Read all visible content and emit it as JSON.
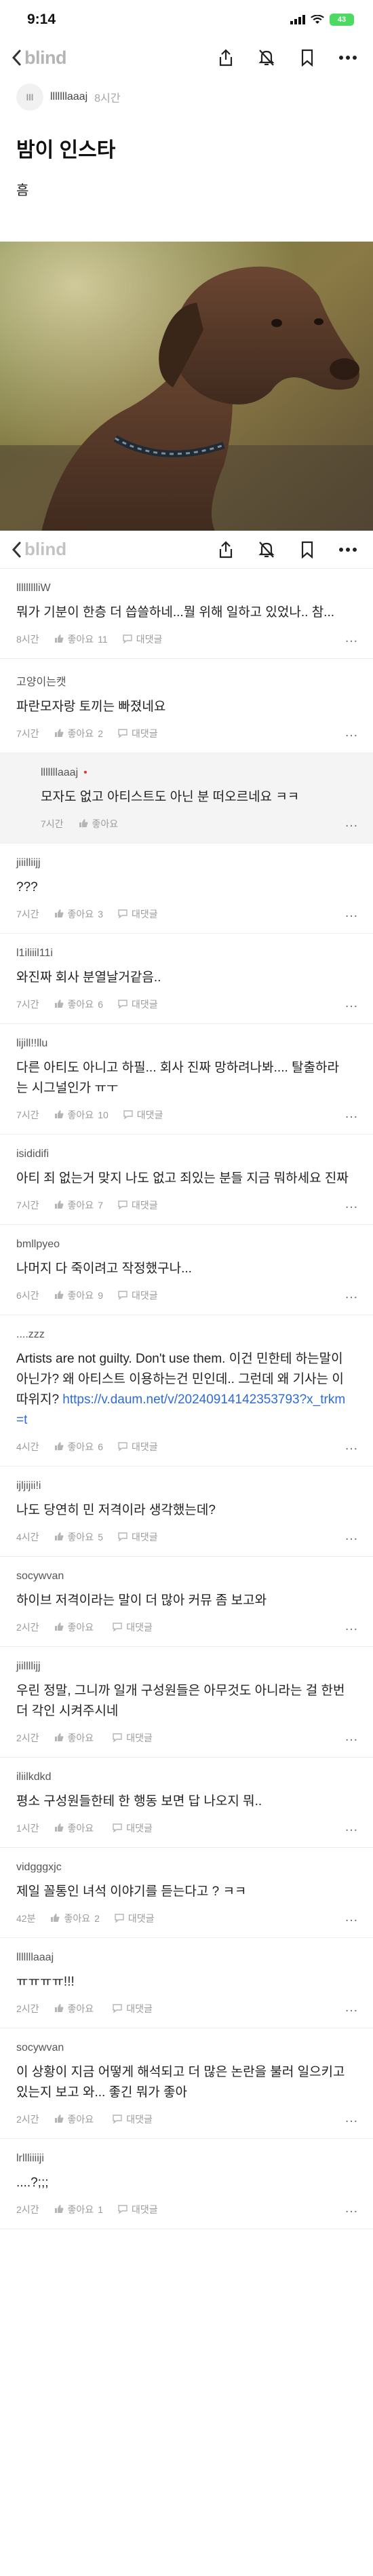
{
  "status": {
    "time": "9:14",
    "battery": "43"
  },
  "nav": {
    "brand": "blind"
  },
  "post": {
    "author": "lllllllaaaj",
    "avatar": "lll",
    "time": "8시간",
    "title": "밤이 인스타",
    "body": "흠"
  },
  "labels": {
    "like": "좋아요",
    "reply": "대댓글"
  },
  "comments": [
    {
      "name": "llllllllliW",
      "text": "뭐가 기분이 한층 더 씁쓸하네...뭘 위해 일하고 있었나.. 참...",
      "time": "8시간",
      "likes": "11",
      "reply": true
    },
    {
      "name": "고양이는캣",
      "text": "파란모자랑 토끼는 빠졌네요",
      "time": "7시간",
      "likes": "2",
      "reply": true
    },
    {
      "name": "lllllllaaaj",
      "badge": "•",
      "text": "모자도 없고 아티스트도 아닌 분 떠오르네요 ㅋㅋ",
      "time": "7시간",
      "likes": "",
      "reply": false,
      "nested": true
    },
    {
      "name": "jiiilliijj",
      "text": "???",
      "time": "7시간",
      "likes": "3",
      "reply": true
    },
    {
      "name": "l1iliiil11i",
      "text": "와진짜 회사 분열날거같음..",
      "time": "7시간",
      "likes": "6",
      "reply": true
    },
    {
      "name": "lijill!!llu",
      "text": "다른 아티도 아니고 하필... 회사 진짜 망하려나봐.... 탈출하라는 시그널인가 ㅠㅜ",
      "time": "7시간",
      "likes": "10",
      "reply": true
    },
    {
      "name": "isididifi",
      "text": "아티 죄 없는거 맞지 나도 없고 죄있는 분들 지금 뭐하세요 진짜",
      "time": "7시간",
      "likes": "7",
      "reply": true
    },
    {
      "name": "bmllpyeo",
      "text": "나머지 다 죽이려고 작정했구나...",
      "time": "6시간",
      "likes": "9",
      "reply": true
    },
    {
      "name": "....zzz",
      "text": "Artists are not guilty.  Don't use them. 이건 민한테 하는말이 아닌가? 왜 아티스트 이용하는건 민인데.. 그런데 왜 기사는 이따위지? ",
      "link": "https://v.daum.net/v/20240914142353793?x_trkm=t",
      "time": "4시간",
      "likes": "6",
      "reply": true
    },
    {
      "name": "ijljijii!i",
      "text": "나도 당연히 민 저격이라 생각했는데?",
      "time": "4시간",
      "likes": "5",
      "reply": true
    },
    {
      "name": "socywvan",
      "text": "하이브 저격이라는 말이 더 많아 커뮤 좀 보고와",
      "time": "2시간",
      "likes": "",
      "reply": true
    },
    {
      "name": "jiillllijj",
      "text": "우린 정말, 그니까 일개 구성원들은 아무것도 아니라는 걸 한번 더 각인 시켜주시네",
      "time": "2시간",
      "likes": "",
      "reply": true
    },
    {
      "name": "iliilkdkd",
      "text": "평소 구성원들한테 한 행동 보면 답 나오지 뭐..",
      "time": "1시간",
      "likes": "",
      "reply": true
    },
    {
      "name": "vidgggxjc",
      "text": "제일 꼴통인 녀석 이야기를 듣는다고 ? ㅋㅋ",
      "time": "42분",
      "likes": "2",
      "reply": true
    },
    {
      "name": "lllllllaaaj",
      "text": "ㅠㅠㅠㅠ!!!",
      "time": "2시간",
      "likes": "",
      "reply": true
    },
    {
      "name": "socywvan",
      "text": "이 상황이 지금 어떻게 해석되고 더 많은 논란을 불러 일으키고 있는지 보고 와... 좋긴 뭐가 좋아",
      "time": "2시간",
      "likes": "",
      "reply": true
    },
    {
      "name": "lrllliiiiji",
      "text": "....?;;;",
      "time": "2시간",
      "likes": "1",
      "reply": true
    }
  ]
}
